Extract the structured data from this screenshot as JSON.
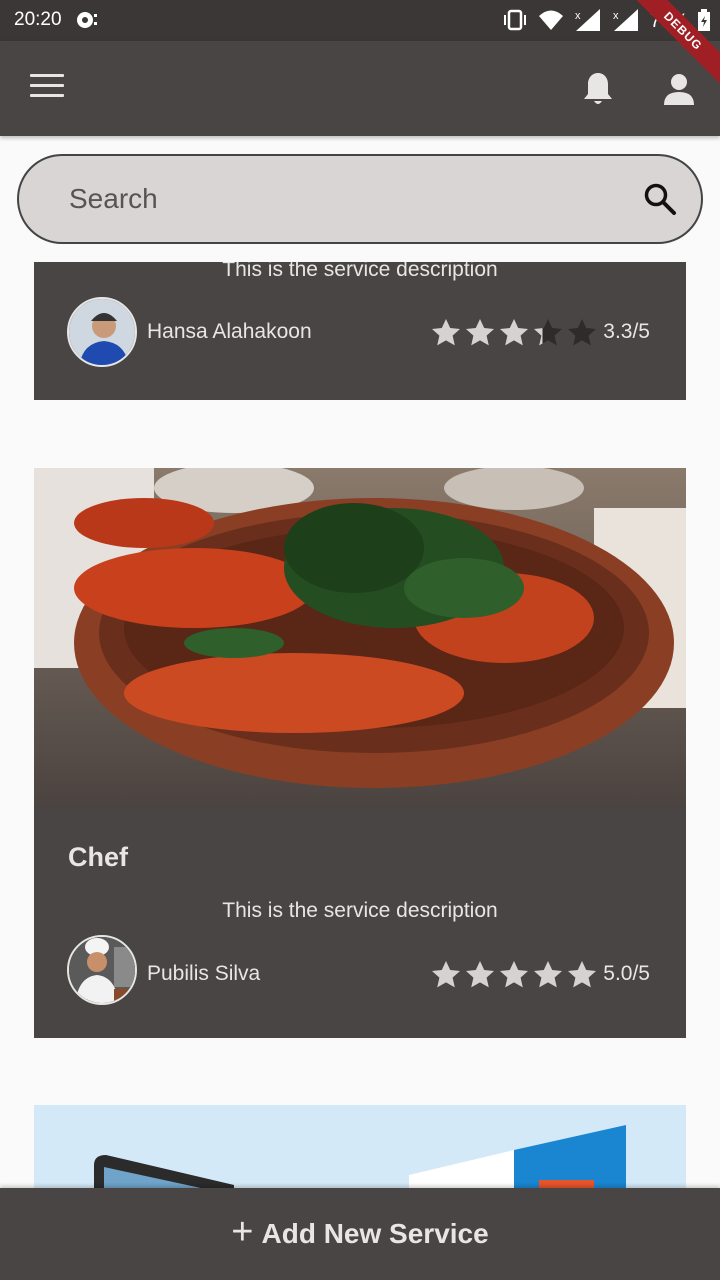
{
  "status_bar": {
    "time": "20:20",
    "battery": "79%",
    "debug_label": "DEBUG"
  },
  "search": {
    "placeholder": "Search"
  },
  "services": [
    {
      "description": "This is the service description",
      "provider": "Hansa Alahakoon",
      "rating_value": 3.3,
      "rating_text": "3.3/5"
    },
    {
      "title": "Chef",
      "description": "This is the service description",
      "provider": "Pubilis Silva",
      "rating_value": 5.0,
      "rating_text": "5.0/5"
    }
  ],
  "bottom_button": {
    "plus": "+",
    "label": "Add New Service"
  },
  "colors": {
    "appbar": "#4a4545",
    "statusbar": "#3b3737",
    "card": "#4a4545",
    "star_filled": "#d6d2d2",
    "star_empty": "#2f2b2b"
  }
}
